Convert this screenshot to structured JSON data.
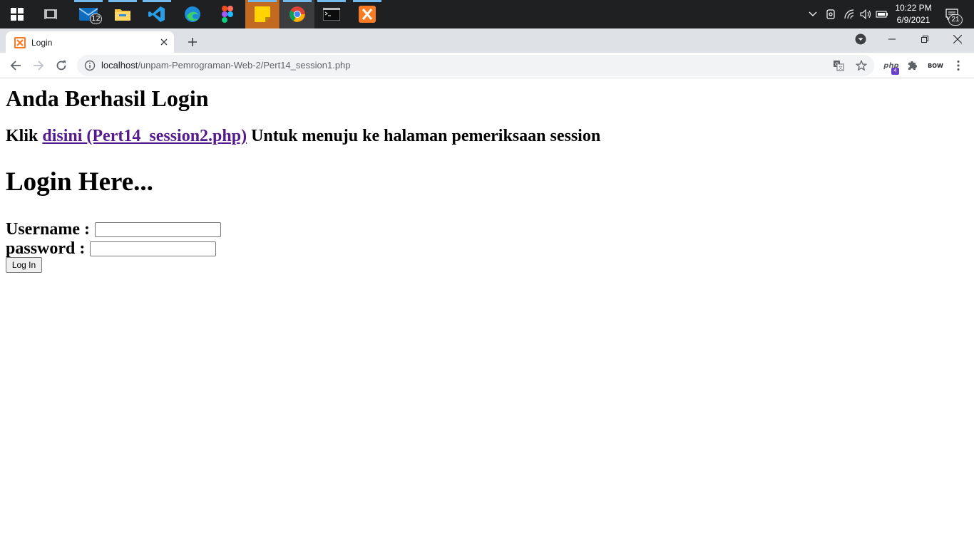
{
  "taskbar": {
    "apps": [
      {
        "name": "mail",
        "badge": "12"
      },
      {
        "name": "file-explorer"
      },
      {
        "name": "vscode"
      },
      {
        "name": "edge"
      },
      {
        "name": "figma"
      },
      {
        "name": "sticky-notes"
      },
      {
        "name": "chrome"
      },
      {
        "name": "terminal"
      },
      {
        "name": "xampp"
      }
    ],
    "clock_time": "10:22 PM",
    "clock_date": "6/9/2021",
    "notification_count": "21"
  },
  "browser": {
    "tab_title": "Login",
    "url_host": "localhost",
    "url_path": "/unpam-Pemrograman-Web-2/Pert14_session1.php",
    "extension_badge": "4",
    "extension_label_php": "php",
    "extension_label_bow": "BOW"
  },
  "page": {
    "heading_success": "Anda Berhasil Login",
    "klik_text": "Klik ",
    "link_text": "disini (Pert14_session2.php)",
    "after_link_text": " Untuk menuju ke halaman pemeriksaan session",
    "login_heading": "Login Here...",
    "username_label": "Username :",
    "username_value": "",
    "password_label": "password :",
    "password_value": "",
    "login_button": "Log In"
  },
  "colors": {
    "taskbar_bg": "#1f2022",
    "tabstrip_bg": "#dee1e6",
    "visited_link": "#551a8b"
  }
}
